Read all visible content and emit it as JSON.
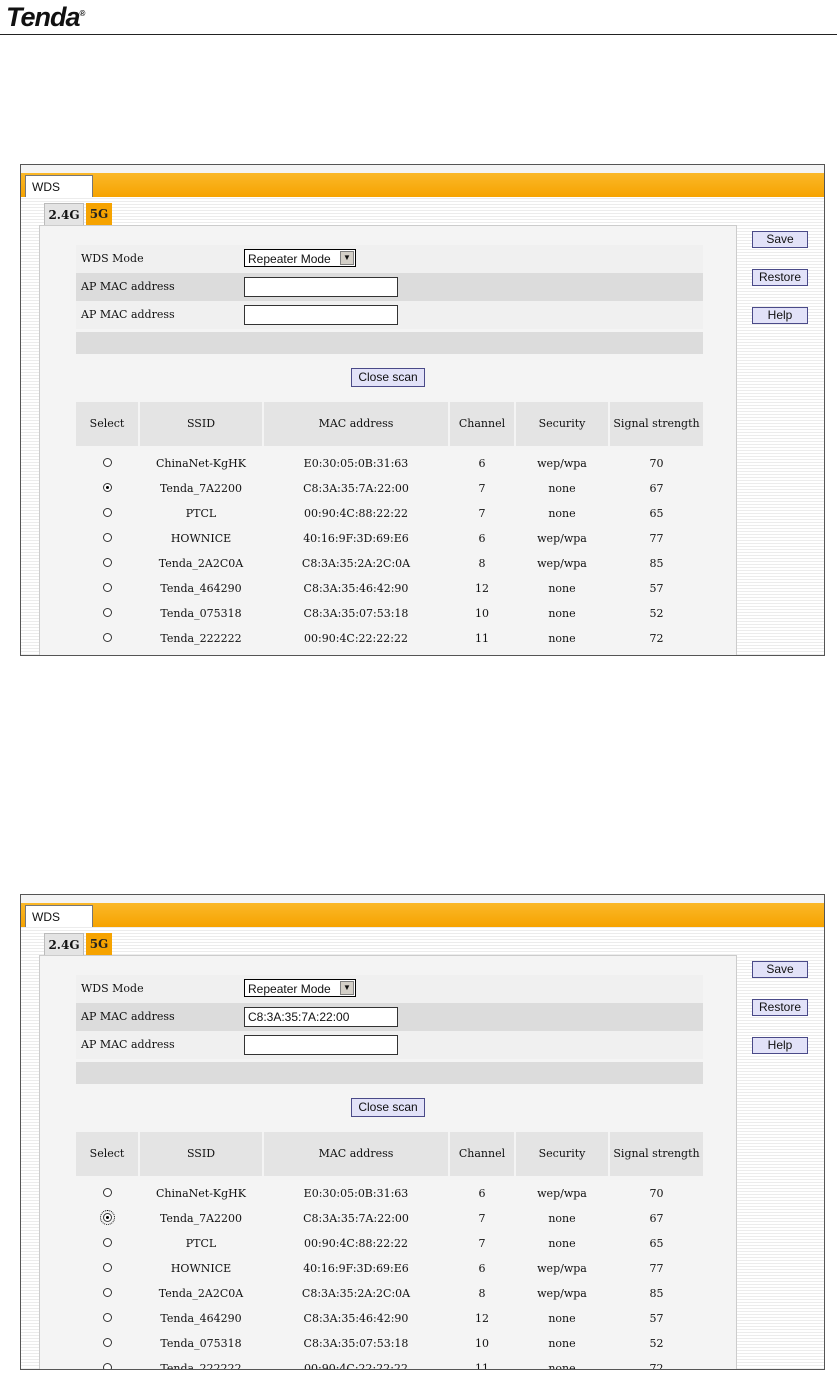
{
  "header": {
    "logo_text": "Tenda",
    "logo_mark": "®"
  },
  "ui": {
    "tab_wds": "WDS",
    "band_24": "2.4G",
    "band_5": "5G",
    "wds_mode_label": "WDS Mode",
    "wds_mode_value": "Repeater Mode",
    "ap_mac_label": "AP MAC address",
    "close_scan": "Close scan",
    "save": "Save",
    "restore": "Restore",
    "help": "Help",
    "dropdown_arrow": "▼"
  },
  "table": {
    "headers": [
      "Select",
      "SSID",
      "MAC address",
      "Channel",
      "Security",
      "Signal strength"
    ],
    "rows": [
      {
        "ssid": "ChinaNet-KgHK",
        "mac": "E0:30:05:0B:31:63",
        "channel": "6",
        "security": "wep/wpa",
        "signal": "70"
      },
      {
        "ssid": "Tenda_7A2200",
        "mac": "C8:3A:35:7A:22:00",
        "channel": "7",
        "security": "none",
        "signal": "67"
      },
      {
        "ssid": "PTCL",
        "mac": "00:90:4C:88:22:22",
        "channel": "7",
        "security": "none",
        "signal": "65"
      },
      {
        "ssid": "HOWNICE",
        "mac": "40:16:9F:3D:69:E6",
        "channel": "6",
        "security": "wep/wpa",
        "signal": "77"
      },
      {
        "ssid": "Tenda_2A2C0A",
        "mac": "C8:3A:35:2A:2C:0A",
        "channel": "8",
        "security": "wep/wpa",
        "signal": "85"
      },
      {
        "ssid": "Tenda_464290",
        "mac": "C8:3A:35:46:42:90",
        "channel": "12",
        "security": "none",
        "signal": "57"
      },
      {
        "ssid": "Tenda_075318",
        "mac": "C8:3A:35:07:53:18",
        "channel": "10",
        "security": "none",
        "signal": "52"
      },
      {
        "ssid": "Tenda_222222",
        "mac": "00:90:4C:22:22:22",
        "channel": "11",
        "security": "none",
        "signal": "72"
      }
    ]
  },
  "screens": [
    {
      "ap_mac_1": "",
      "ap_mac_2": "",
      "selected_row": 1
    },
    {
      "ap_mac_1": "C8:3A:35:7A:22:00",
      "ap_mac_2": "",
      "selected_row": 1
    }
  ]
}
